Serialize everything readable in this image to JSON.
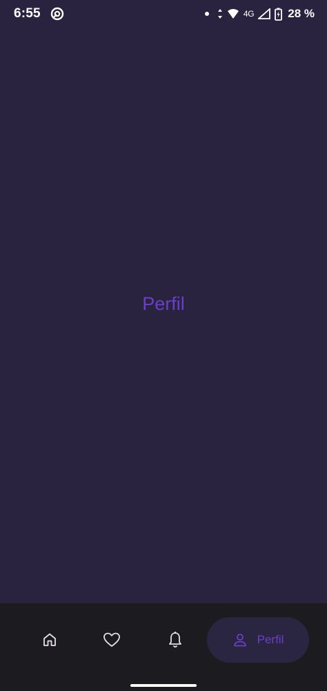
{
  "status_bar": {
    "time": "6:55",
    "network": "4G",
    "battery": "28 %",
    "icons": [
      "sync-icon",
      "dot-icon",
      "data-arrows-icon",
      "wifi-icon",
      "signal-icon",
      "battery-charging-icon"
    ]
  },
  "main": {
    "title": "Perfil"
  },
  "bottom_nav": {
    "items": [
      {
        "icon": "home-icon",
        "label": ""
      },
      {
        "icon": "heart-icon",
        "label": ""
      },
      {
        "icon": "bell-icon",
        "label": ""
      },
      {
        "icon": "person-icon",
        "label": "Perfil",
        "selected": true
      }
    ]
  },
  "colors": {
    "background": "#292340",
    "nav_background": "#1c1b1f",
    "accent": "#6a3fc8",
    "selected_pill": "#2a2540"
  }
}
